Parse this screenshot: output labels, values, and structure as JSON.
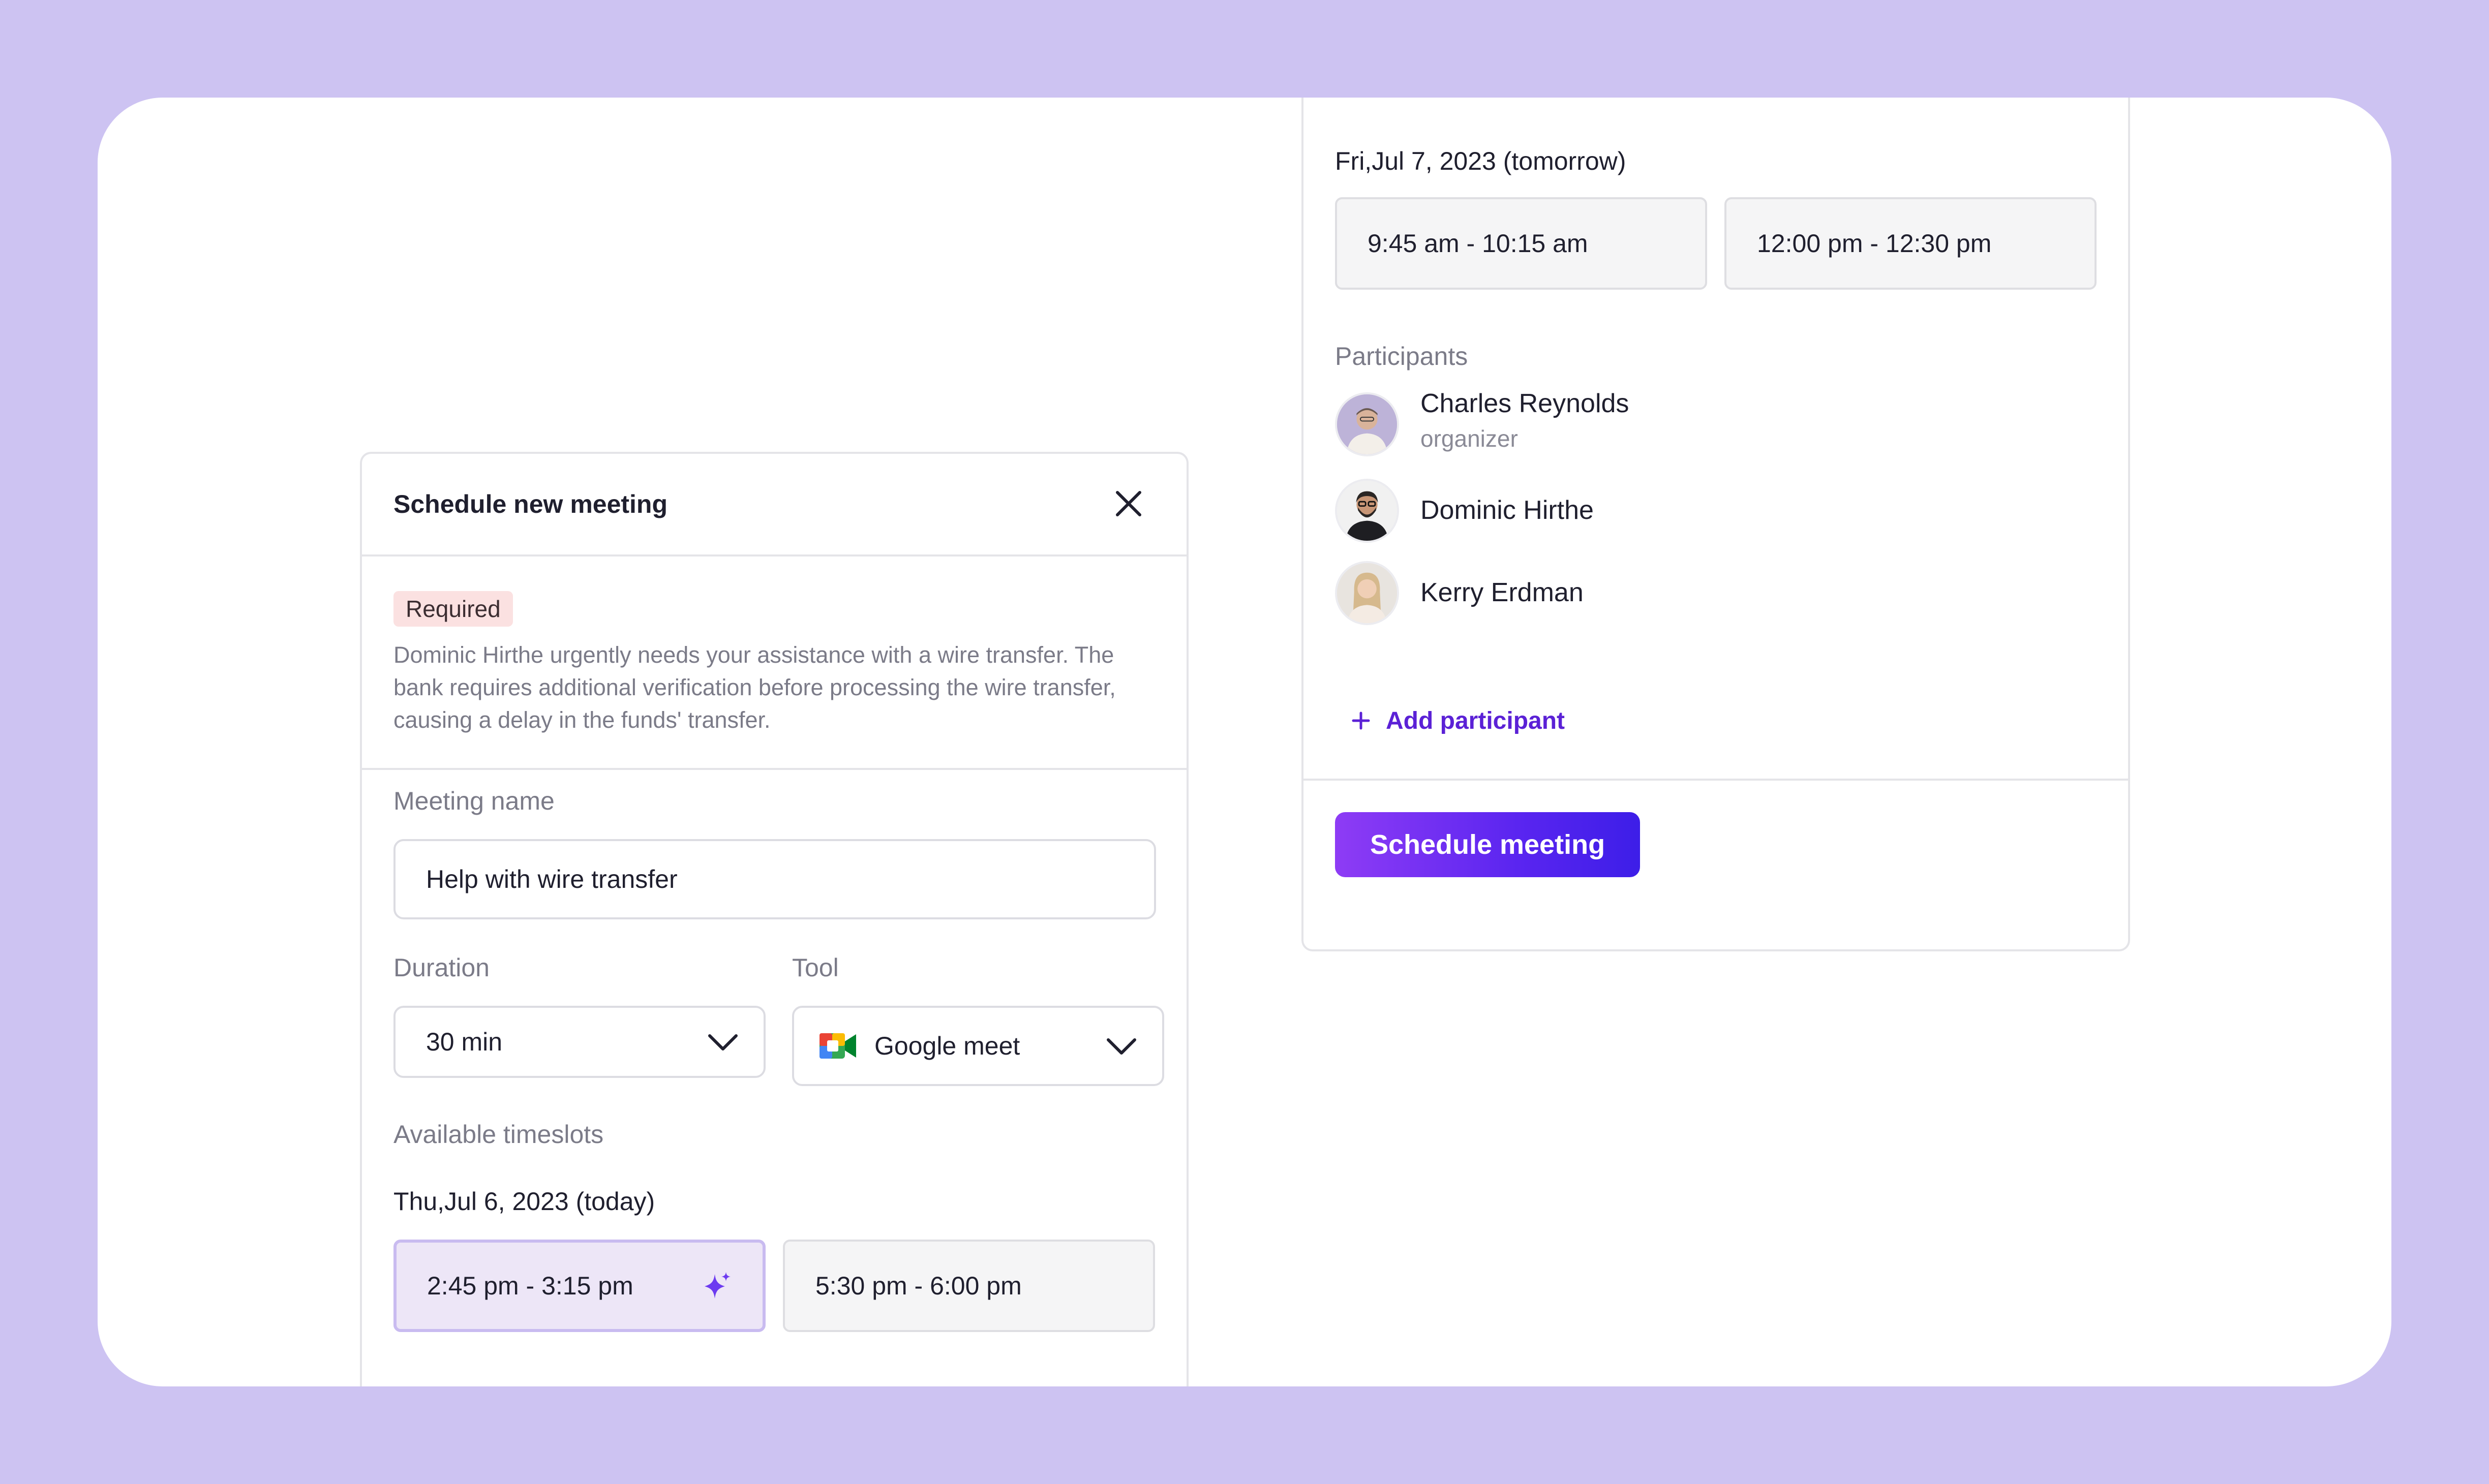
{
  "modal": {
    "title": "Schedule new meeting",
    "badge": "Required",
    "notice": "Dominic Hirthe urgently needs your assistance with a wire transfer. The bank requires additional verification before processing the wire transfer, causing a delay in the funds' transfer.",
    "meeting_name_label": "Meeting name",
    "meeting_name_value": "Help with wire transfer",
    "duration_label": "Duration",
    "duration_value": "30 min",
    "tool_label": "Tool",
    "tool_value": "Google meet",
    "timeslots_label": "Available timeslots",
    "day1": {
      "date": "Thu,Jul 6, 2023 (today)",
      "slots": [
        "2:45 pm - 3:15 pm",
        "5:30 pm - 6:00 pm"
      ]
    },
    "day2": {
      "date": "Fri,Jul 7, 2023 (tomorrow)",
      "slots": [
        "9:45 am - 10:15 am",
        "12:00 pm - 12:30 pm"
      ]
    },
    "participants_label": "Participants",
    "participants": [
      {
        "name": "Charles Reynolds",
        "role": "organizer"
      },
      {
        "name": "Dominic Hirthe",
        "role": ""
      },
      {
        "name": "Kerry Erdman",
        "role": ""
      }
    ],
    "add_participant": "Add participant",
    "schedule_button": "Schedule meeting"
  },
  "colors": {
    "background": "#cdc3f2",
    "accent": "#5b21d6",
    "badge_bg": "#fbe1e1",
    "selected_slot_bg": "#ede6f7"
  },
  "icons": [
    "close-icon",
    "chevron-down-icon",
    "google-meet-icon",
    "sparkle-icon",
    "plus-icon"
  ]
}
